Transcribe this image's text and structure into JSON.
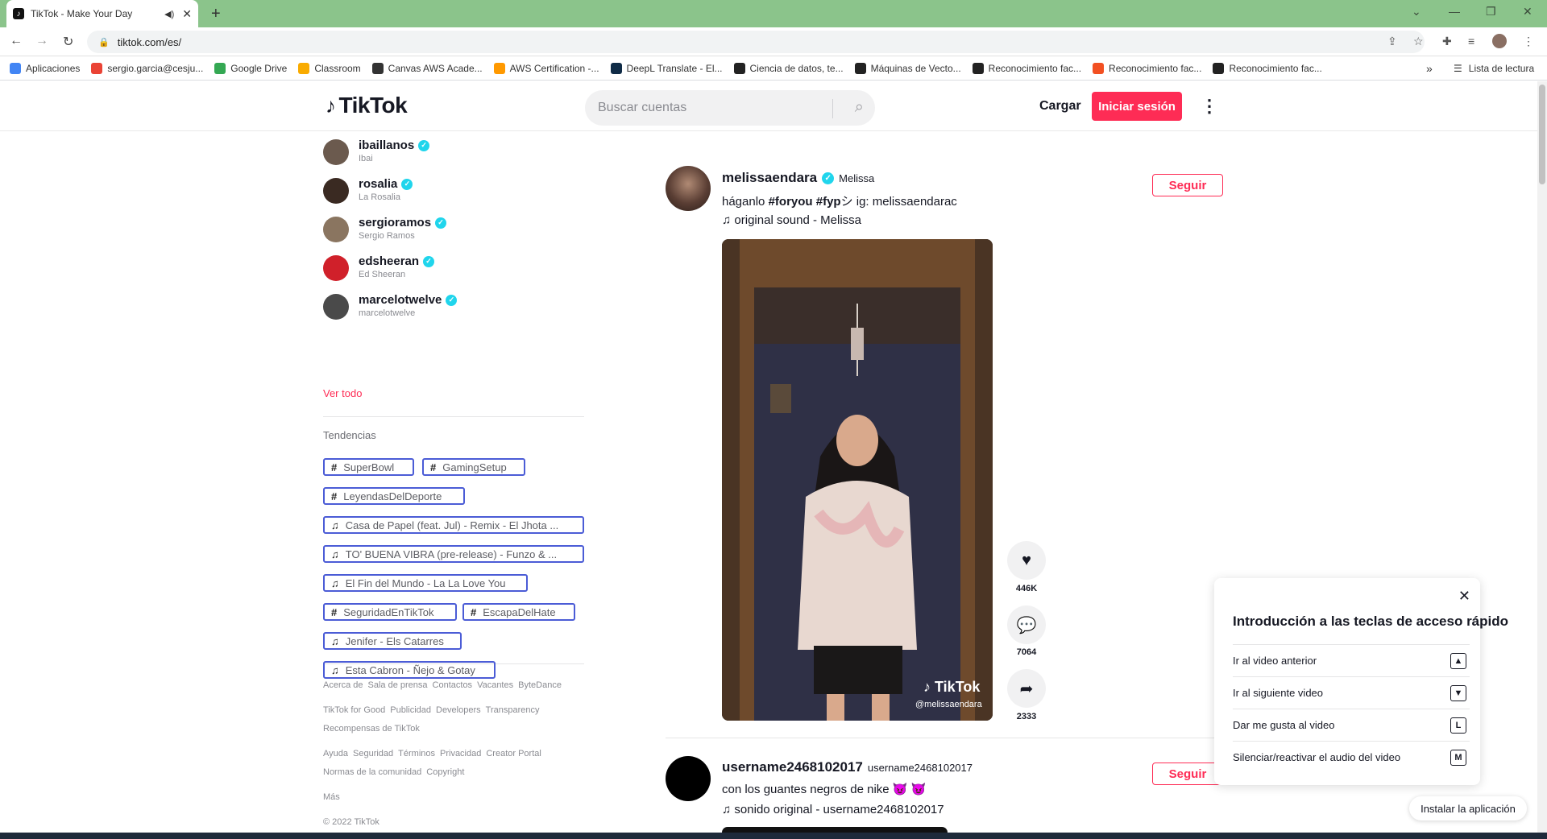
{
  "browser": {
    "tab_title": "TikTok - Make Your Day",
    "new_tab": "+",
    "url": "tiktok.com/es/",
    "bookmarks": [
      {
        "label": "Aplicaciones",
        "icon": "apps-grid-icon",
        "color": "#4285f4"
      },
      {
        "label": "sergio.garcia@cesju...",
        "icon": "gmail-icon",
        "color": "#ea4335"
      },
      {
        "label": "Google Drive",
        "icon": "drive-icon",
        "color": "#34a853"
      },
      {
        "label": "Classroom",
        "icon": "classroom-icon",
        "color": "#f9ab00"
      },
      {
        "label": "Canvas AWS Acade...",
        "icon": "canvas-icon",
        "color": "#333333"
      },
      {
        "label": "AWS Certification -...",
        "icon": "aws-icon",
        "color": "#ff9900"
      },
      {
        "label": "DeepL Translate - El...",
        "icon": "deepl-icon",
        "color": "#0f2b46"
      },
      {
        "label": "Ciencia de datos, te...",
        "icon": "globe-icon",
        "color": "#222222"
      },
      {
        "label": "Máquinas de Vecto...",
        "icon": "globe-icon",
        "color": "#222222"
      },
      {
        "label": "Reconocimiento fac...",
        "icon": "globe-icon",
        "color": "#222222"
      },
      {
        "label": "Reconocimiento fac...",
        "icon": "microsoft-icon",
        "color": "#f25022"
      },
      {
        "label": "Reconocimiento fac...",
        "icon": "globe-icon",
        "color": "#222222"
      }
    ],
    "bookmarks_more": "»",
    "reading_list": "Lista de lectura"
  },
  "header": {
    "logo": "TikTok",
    "search_placeholder": "Buscar cuentas",
    "upload": "Cargar",
    "login": "Iniciar sesión"
  },
  "sidebar": {
    "accounts": [
      {
        "username": "ibaillanos",
        "nickname": "Ibai",
        "avatar_color": "#6b5a4e"
      },
      {
        "username": "rosalia",
        "nickname": "La Rosalia",
        "avatar_color": "#3a2a22"
      },
      {
        "username": "sergioramos",
        "nickname": "Sergio Ramos",
        "avatar_color": "#8a7560"
      },
      {
        "username": "edsheeran",
        "nickname": "Ed Sheeran",
        "avatar_color": "#d0202a"
      },
      {
        "username": "marcelotwelve",
        "nickname": "marcelotwelve",
        "avatar_color": "#4a4a4a"
      }
    ],
    "see_all": "Ver todo",
    "trends_title": "Tendencias",
    "trends": [
      {
        "type": "hashtag",
        "label": "SuperBowl"
      },
      {
        "type": "hashtag",
        "label": "GamingSetup"
      },
      {
        "type": "hashtag",
        "label": "LeyendasDelDeporte"
      },
      {
        "type": "music",
        "label": "Casa de Papel (feat. Jul) - Remix - El Jhota ..."
      },
      {
        "type": "music",
        "label": "TO' BUENA VIBRA (pre-release) - Funzo & ..."
      },
      {
        "type": "music",
        "label": "El Fin del Mundo - La La Love You"
      },
      {
        "type": "hashtag",
        "label": "SeguridadEnTikTok"
      },
      {
        "type": "hashtag",
        "label": "EscapaDelHate"
      },
      {
        "type": "music",
        "label": "Jenifer - Els Catarres"
      },
      {
        "type": "music",
        "label": "Esta Cabron - Ñejo & Gotay"
      }
    ],
    "footer": [
      [
        "Acerca de",
        "Sala de prensa",
        "Contactos",
        "Vacantes",
        "ByteDance"
      ],
      [
        "TikTok for Good",
        "Publicidad",
        "Developers",
        "Transparency"
      ],
      [
        "Recompensas de TikTok"
      ],
      [
        "Ayuda",
        "Seguridad",
        "Términos",
        "Privacidad",
        "Creator Portal"
      ],
      [
        "Normas de la comunidad",
        "Copyright"
      ],
      [
        "Más"
      ],
      [
        "© 2022 TikTok"
      ]
    ]
  },
  "feed": {
    "posts": [
      {
        "username": "melissaendara",
        "nickname": "Melissa",
        "desc_prefix": "háganlo ",
        "desc_tags": "#foryou #fyp",
        "desc_suffix": "シ ig: melissaendarac",
        "sound": "original sound - Melissa",
        "follow": "Seguir",
        "likes": "446K",
        "comments": "7064",
        "shares": "2333",
        "watermark_logo": "TikTok",
        "watermark_user": "@melissaendara"
      },
      {
        "username": "username2468102017",
        "nickname": "username2468102017",
        "desc": "con los guantes negros de nike 😈 😈",
        "sound": "sonido original - username2468102017",
        "follow": "Seguir"
      }
    ]
  },
  "shortcuts": {
    "title": "Introducción a las teclas de acceso rápido",
    "items": [
      {
        "label": "Ir al video anterior",
        "key": "▲"
      },
      {
        "label": "Ir al siguiente video",
        "key": "▼"
      },
      {
        "label": "Dar me gusta al video",
        "key": "L"
      },
      {
        "label": "Silenciar/reactivar el audio del video",
        "key": "M"
      }
    ]
  },
  "install_app": "Instalar la aplicación",
  "colors": {
    "accent": "#fe2c55",
    "verified": "#20d5ec",
    "tag_border": "#4b5cd6"
  }
}
